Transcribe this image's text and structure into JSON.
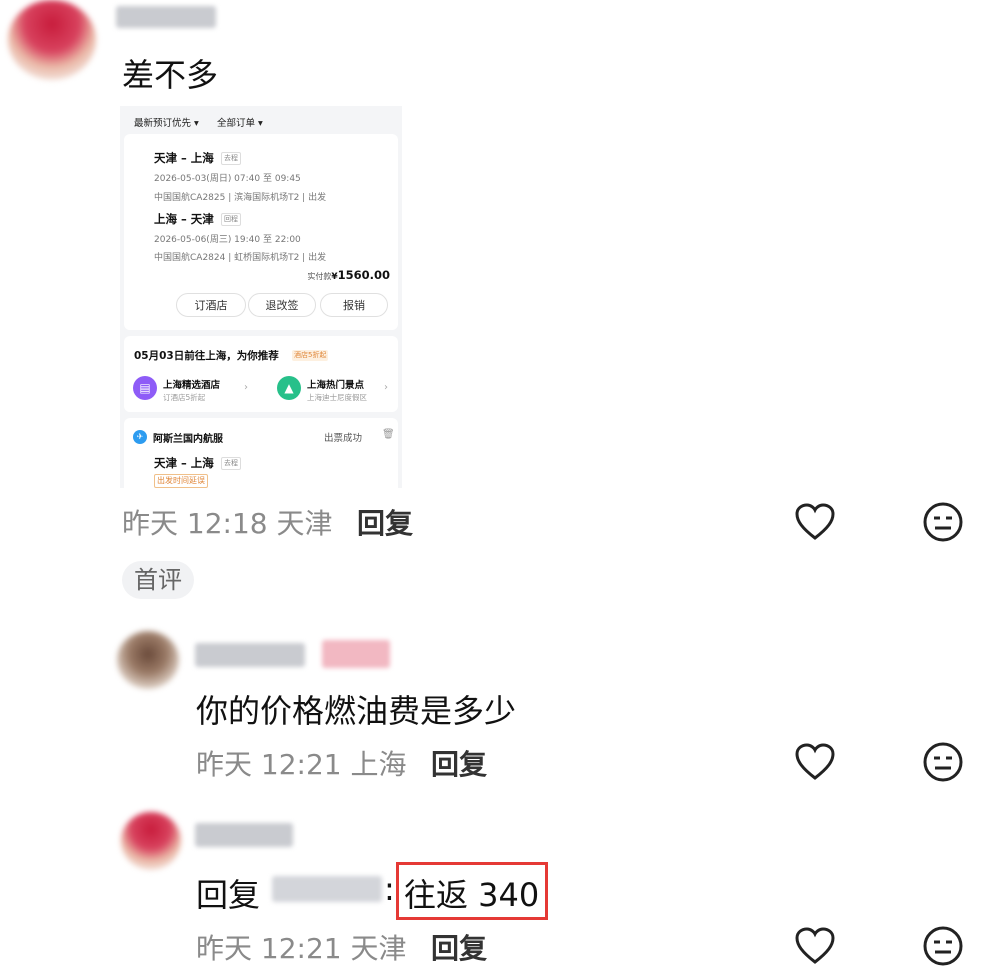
{
  "comment1": {
    "text": "差不多",
    "time": "昨天 12:18",
    "location": "天津",
    "reply_label": "回复",
    "first_comment_badge": "首评"
  },
  "screenshot": {
    "sort_filter": "最新预订优先",
    "order_filter": "全部订单",
    "leg1": {
      "route": "天津 – 上海",
      "tag": "去程",
      "datetime": "2026-05-03(周日) 07:40 至 09:45",
      "flight": "中国国航CA2825 | 滨海国际机场T2 | 出发"
    },
    "leg2": {
      "route": "上海 – 天津",
      "tag": "回程",
      "datetime": "2026-05-06(周三) 19:40 至 22:00",
      "flight": "中国国航CA2824 | 虹桥国际机场T2 | 出发"
    },
    "paid_label": "实付款",
    "paid_currency": "¥",
    "paid_amount": "1560.00",
    "buttons": [
      "订酒店",
      "退改签",
      "报销"
    ],
    "recommend": {
      "title": "05月03日前往上海，为你推荐",
      "badge": "酒店5折起",
      "hotel_title": "上海精选酒店",
      "hotel_sub": "订酒店5折起",
      "spot_title": "上海热门景点",
      "spot_sub": "上海迪士尼度假区"
    },
    "order2": {
      "airline": "阿斯兰国内航服",
      "status": "出票成功",
      "route": "天津 – 上海",
      "tag": "去程",
      "delay": "出发时间延误"
    }
  },
  "reply1": {
    "text": "你的价格燃油费是多少",
    "time": "昨天 12:21",
    "location": "上海",
    "reply_label": "回复"
  },
  "reply2": {
    "prefix": "回复",
    "separator": ":",
    "text": "往返 340",
    "time": "昨天 12:21",
    "location": "天津",
    "reply_label": "回复"
  },
  "colors": {
    "highlight_border": "#e53935",
    "meta_text": "#8a8a8a",
    "purple_icon": "#8e5cf7",
    "green_icon": "#27c08a",
    "blue_icon": "#2d9cf0"
  }
}
